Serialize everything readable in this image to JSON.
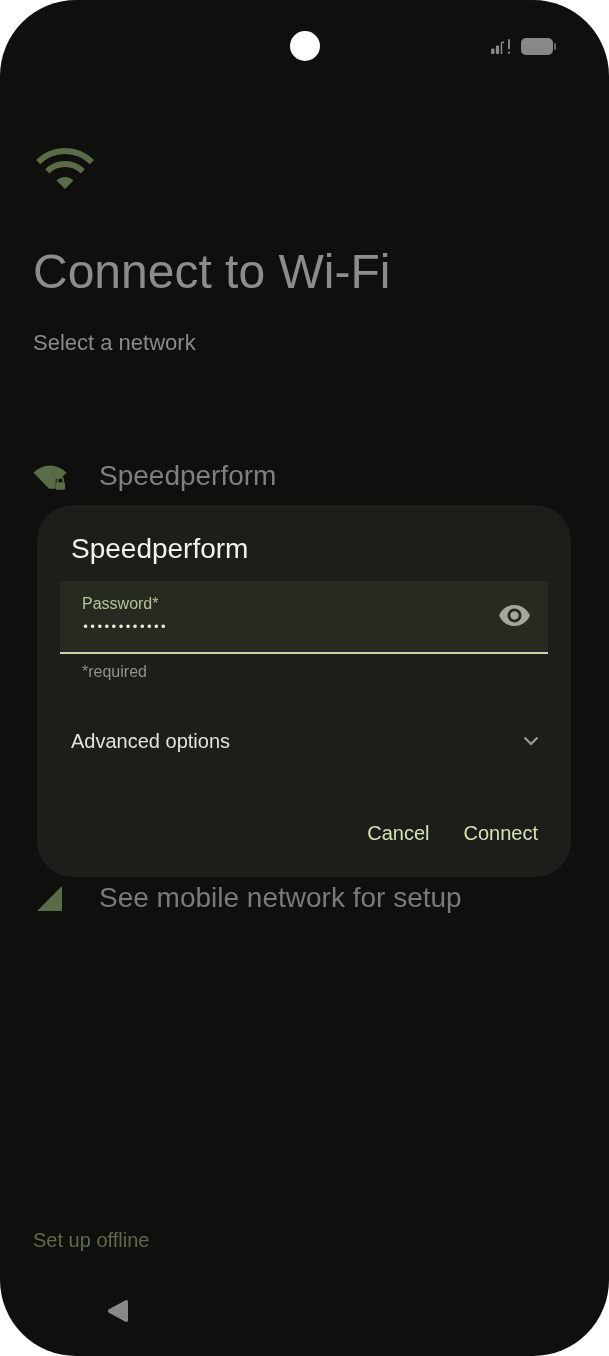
{
  "header": {
    "title": "Connect to Wi-Fi",
    "subtitle": "Select a network"
  },
  "networks": [
    {
      "name": "Speedperform",
      "kind": "wifi_locked"
    }
  ],
  "mobile_option": {
    "label": "See mobile network for setup"
  },
  "dialog": {
    "title": "Speedperform",
    "password_field": {
      "label": "Password*",
      "value": "••••••••••••",
      "helper": "*required"
    },
    "advanced_options": {
      "label": "Advanced options",
      "expanded": false
    },
    "buttons": [
      "Cancel",
      "Connect"
    ]
  },
  "footer": {
    "offline_link": "Set up offline"
  }
}
